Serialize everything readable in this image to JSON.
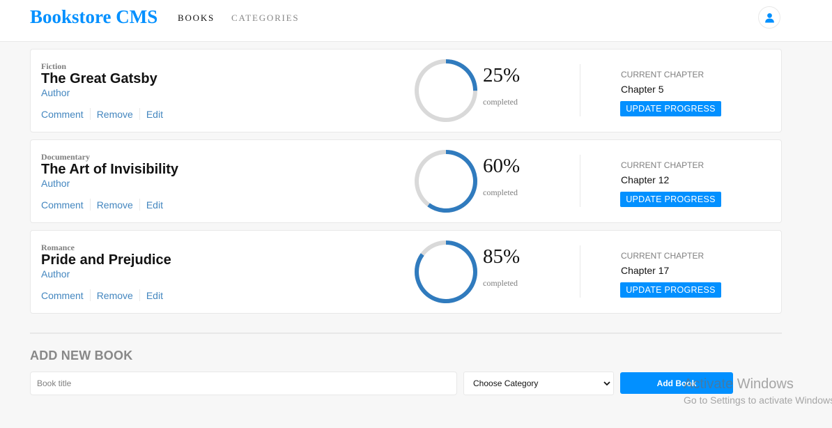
{
  "header": {
    "logo": "Bookstore CMS",
    "nav": [
      {
        "label": "BOOKS",
        "active": true
      },
      {
        "label": "CATEGORIES",
        "active": false
      }
    ],
    "user_icon": "user-icon"
  },
  "books": [
    {
      "category": "Fiction",
      "title": "The Great Gatsby",
      "author": "Author",
      "actions": [
        "Comment",
        "Remove",
        "Edit"
      ],
      "progress": 25,
      "percent_text": "25%",
      "completed_label": "completed",
      "chapter_label": "CURRENT CHAPTER",
      "chapter": "Chapter 5",
      "update_label": "UPDATE PROGRESS"
    },
    {
      "category": "Documentary",
      "title": "The Art of Invisibility",
      "author": "Author",
      "actions": [
        "Comment",
        "Remove",
        "Edit"
      ],
      "progress": 60,
      "percent_text": "60%",
      "completed_label": "completed",
      "chapter_label": "CURRENT CHAPTER",
      "chapter": "Chapter 12",
      "update_label": "UPDATE PROGRESS"
    },
    {
      "category": "Romance",
      "title": "Pride and Prejudice",
      "author": "Author",
      "actions": [
        "Comment",
        "Remove",
        "Edit"
      ],
      "progress": 85,
      "percent_text": "85%",
      "completed_label": "completed",
      "chapter_label": "CURRENT CHAPTER",
      "chapter": "Chapter 17",
      "update_label": "UPDATE PROGRESS"
    }
  ],
  "add_form": {
    "title": "ADD NEW BOOK",
    "title_placeholder": "Book title",
    "category_selected": "Choose Category",
    "submit_label": "Add Book"
  },
  "watermark": {
    "title": "Activate Windows",
    "subtitle": "Go to Settings to activate Windows."
  },
  "colors": {
    "accent": "#0290ff",
    "link": "#4386bf",
    "progress": "#307bbe",
    "track": "#d9d9d9",
    "background": "#f7f7f7"
  }
}
